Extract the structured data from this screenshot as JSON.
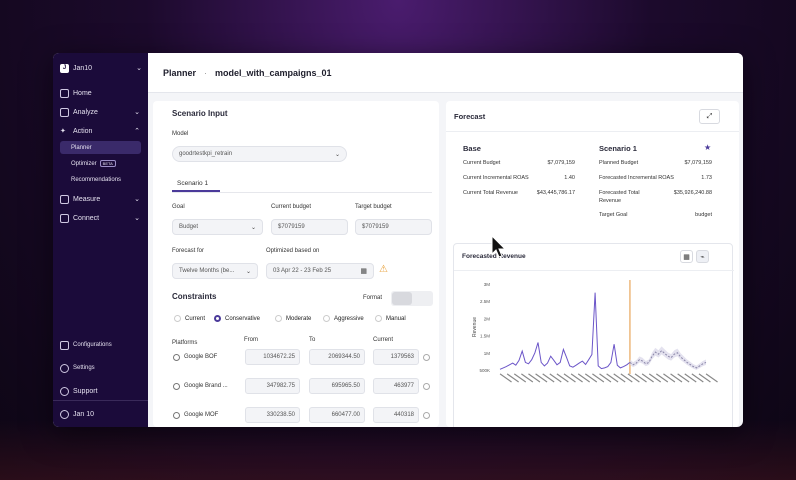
{
  "sidebar": {
    "workspace": "Jan10",
    "nav": [
      {
        "label": "Home"
      },
      {
        "label": "Analyze"
      },
      {
        "label": "Action"
      },
      {
        "label": "Measure"
      },
      {
        "label": "Connect"
      }
    ],
    "sub": [
      {
        "label": "Planner"
      },
      {
        "label": "Optimizer",
        "badge": "BETA"
      },
      {
        "label": "Recommendations"
      }
    ],
    "bottom": [
      {
        "label": "Configurations"
      },
      {
        "label": "Settings"
      },
      {
        "label": "Support"
      }
    ],
    "user": "Jan 10"
  },
  "header": {
    "section": "Planner",
    "model": "model_with_campaigns_01"
  },
  "scenario": {
    "title": "Scenario Input",
    "model_label": "Model",
    "model_value": "goodrtestkpi_retrain",
    "tab": "Scenario 1",
    "goal_label": "Goal",
    "goal_value": "Budget",
    "current_budget_label": "Current budget",
    "current_budget_value": "$7079159",
    "target_budget_label": "Target budget",
    "target_budget_value": "$7079159",
    "forecast_for_label": "Forecast for",
    "forecast_for_value": "Twelve Months (be...",
    "optimized_label": "Optimized based on",
    "optimized_value": "03 Apr 22 - 23 Feb 25",
    "constraints_title": "Constraints",
    "format_label": "Format",
    "constraint_options": [
      "Current",
      "Conservative",
      "Moderate",
      "Aggressive",
      "Manual"
    ],
    "selected_constraint": "Conservative",
    "table_headers": {
      "platforms": "Platforms",
      "from": "From",
      "to": "To",
      "current": "Current"
    },
    "rows": [
      {
        "name": "Google BOF",
        "from": "1034672.25",
        "to": "2069344.50",
        "current": "1379563"
      },
      {
        "name": "Google Brand ...",
        "from": "347982.75",
        "to": "695965.50",
        "current": "463977"
      },
      {
        "name": "Google MOF",
        "from": "330238.50",
        "to": "660477.00",
        "current": "440318"
      }
    ]
  },
  "forecast": {
    "title": "Forecast",
    "base": {
      "title": "Base",
      "rows": [
        {
          "label": "Current Budget",
          "value": "$7,079,159"
        },
        {
          "label": "Current Incremental ROAS",
          "value": "1.40"
        },
        {
          "label": "Current Total Revenue",
          "value": "$43,445,786.17"
        }
      ]
    },
    "scenario": {
      "title": "Scenario 1",
      "rows": [
        {
          "label": "Planned Budget",
          "value": "$7,079,159"
        },
        {
          "label": "Forecasted Incremental ROAS",
          "value": "1.73"
        },
        {
          "label": "Forecasted Total",
          "value": "$35,926,240.88"
        },
        {
          "label": "Revenue",
          "value": ""
        },
        {
          "label": "Target Goal",
          "value": "budget"
        }
      ]
    },
    "chart_title": "Forecasted Revenue"
  },
  "colors": {
    "sidebar": "#1b0b3a",
    "accent": "#4b3a9a",
    "actual_line": "#6b55c8",
    "forecast_line": "#8a86a8",
    "divider_line": "#e8a65b"
  },
  "chart_data": {
    "type": "line",
    "title": "",
    "ylabel": "Revenue",
    "yticks": [
      "3M",
      "2.5M",
      "2M",
      "1.5M",
      "1M",
      "500K"
    ],
    "ylim": [
      500000,
      3000000
    ],
    "series": [
      {
        "values": [
          520000,
          560000,
          600000,
          650000,
          700000,
          640000,
          780000,
          1050000,
          720000,
          680000,
          800000,
          1000000,
          1300000,
          720000,
          620000,
          700000,
          900000,
          780000,
          650000,
          720000,
          1100000,
          860000,
          620000,
          580000,
          640000,
          700000,
          760000,
          660000,
          800000,
          950000,
          2750000,
          620000,
          540000,
          560000,
          600000,
          720000,
          1250000,
          640000,
          560000,
          600000,
          650000,
          720000
        ]
      },
      {
        "values": [
          720000,
          650000,
          700000,
          800000,
          760000,
          680000,
          720000,
          900000,
          1020000,
          960000,
          1060000,
          980000,
          900000,
          860000,
          960000,
          1000000,
          880000,
          800000,
          720000,
          660000,
          600000,
          560000,
          620000,
          680000,
          720000
        ]
      }
    ]
  }
}
